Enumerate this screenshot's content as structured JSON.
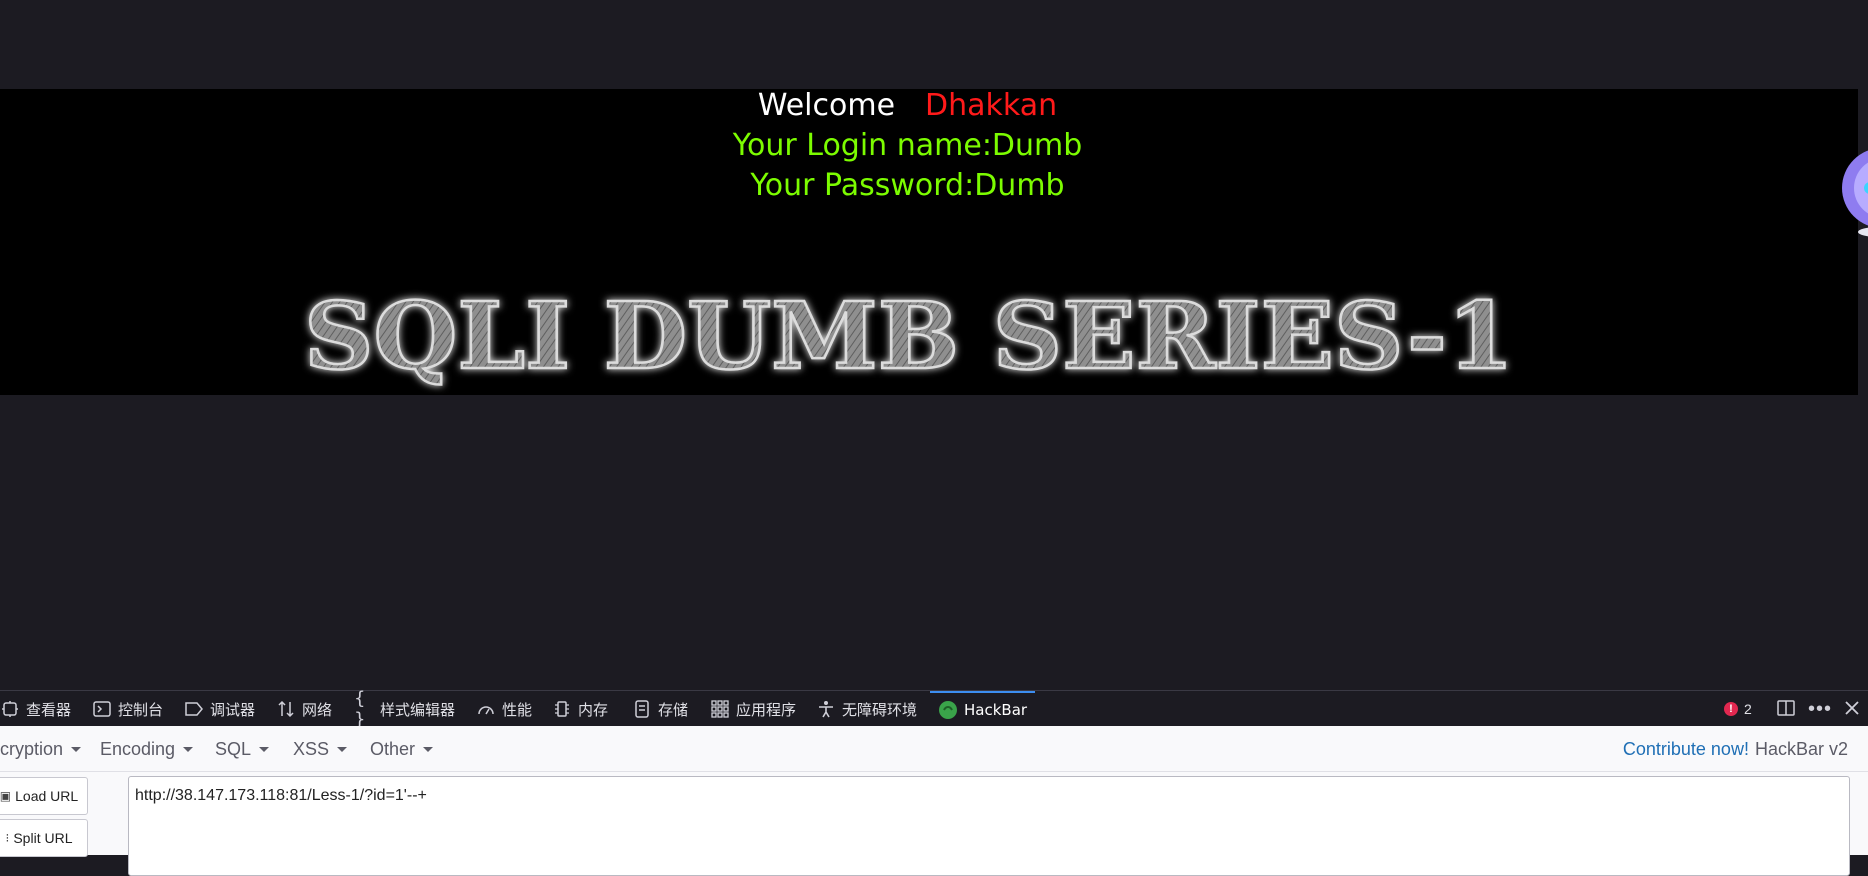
{
  "page": {
    "welcome_label": "Welcome",
    "user_name": "Dhakkan",
    "login_line": "Your Login name:Dumb",
    "password_line": "Your Password:Dumb",
    "banner_text": "SQLI DUMB SERIES-1"
  },
  "devtools": {
    "tabs": [
      {
        "label": "查看器",
        "icon": "inspector-icon"
      },
      {
        "label": "控制台",
        "icon": "console-icon"
      },
      {
        "label": "调试器",
        "icon": "debugger-icon"
      },
      {
        "label": "网络",
        "icon": "network-icon"
      },
      {
        "label": "样式编辑器",
        "icon": "style-editor-icon"
      },
      {
        "label": "性能",
        "icon": "performance-icon"
      },
      {
        "label": "内存",
        "icon": "memory-icon"
      },
      {
        "label": "存储",
        "icon": "storage-icon"
      },
      {
        "label": "应用程序",
        "icon": "application-icon"
      },
      {
        "label": "无障碍环境",
        "icon": "accessibility-icon"
      },
      {
        "label": "HackBar",
        "icon": "hackbar-icon"
      }
    ],
    "active_tab": "HackBar",
    "error_count": "2"
  },
  "hackbar": {
    "menus": [
      "cryption",
      "Encoding",
      "SQL",
      "XSS",
      "Other"
    ],
    "contribute_link": "Contribute now!",
    "version": "HackBar v2",
    "load_url_label": "Load URL",
    "split_url_label": "Split URL",
    "url_value": "http://38.147.173.118:81/Less-1/?id=1'--+"
  },
  "colors": {
    "page_bg": "#1c1b22",
    "panel_bg": "#000000",
    "name_red": "#ff1a1a",
    "info_green": "#7cfc00",
    "active_tab_accent": "#3d8ef0",
    "link_blue": "#1f6fb5"
  }
}
